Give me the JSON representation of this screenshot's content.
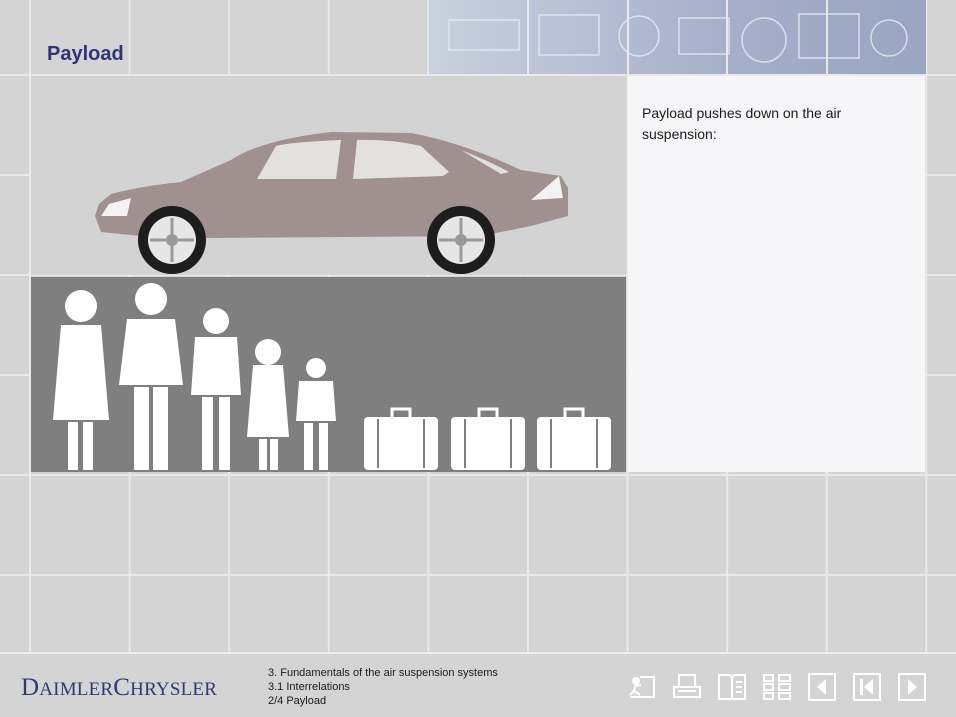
{
  "page": {
    "title": "Payload"
  },
  "panel": {
    "text": "Payload pushes down on the air suspension:"
  },
  "footer": {
    "logo": "DaimlerChrysler",
    "breadcrumb": [
      "3. Fundamentals of the air suspension systems",
      "3.1 Interrelations",
      "2/4 Payload"
    ]
  },
  "toolbar": {
    "icons": [
      "exit-icon",
      "print-icon",
      "glossary-icon",
      "contents-icon",
      "previous-icon",
      "back-to-start-icon",
      "next-icon"
    ]
  },
  "colors": {
    "title": "#2e3576",
    "car_body": "#a09090",
    "people_background": "#7f7f80",
    "text_panel": "#f6f5f7"
  }
}
